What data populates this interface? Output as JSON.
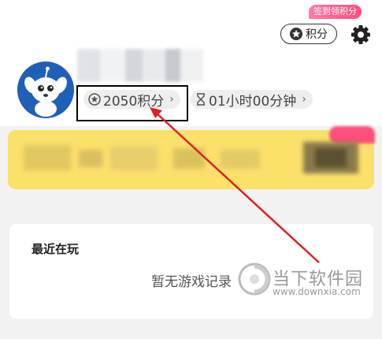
{
  "header": {
    "sign_badge": "签到领积分",
    "points_button_label": "积分"
  },
  "profile": {
    "points_chip": "2050积分",
    "time_chip": "01小时00分钟"
  },
  "recent": {
    "title": "最近在玩",
    "empty_text": "暂无游戏记录"
  },
  "watermark": {
    "name": "当下软件园",
    "url": "www.downxia.com"
  },
  "colors": {
    "highlight_box": "#000000",
    "arrow": "#e02020",
    "vip_card": "#fbe06a",
    "avatar_bg": "#1e5fb8",
    "badge": "#ff4f7a"
  },
  "icons": [
    "star-icon",
    "gear-icon",
    "chevron-right-icon",
    "hourglass-icon"
  ]
}
